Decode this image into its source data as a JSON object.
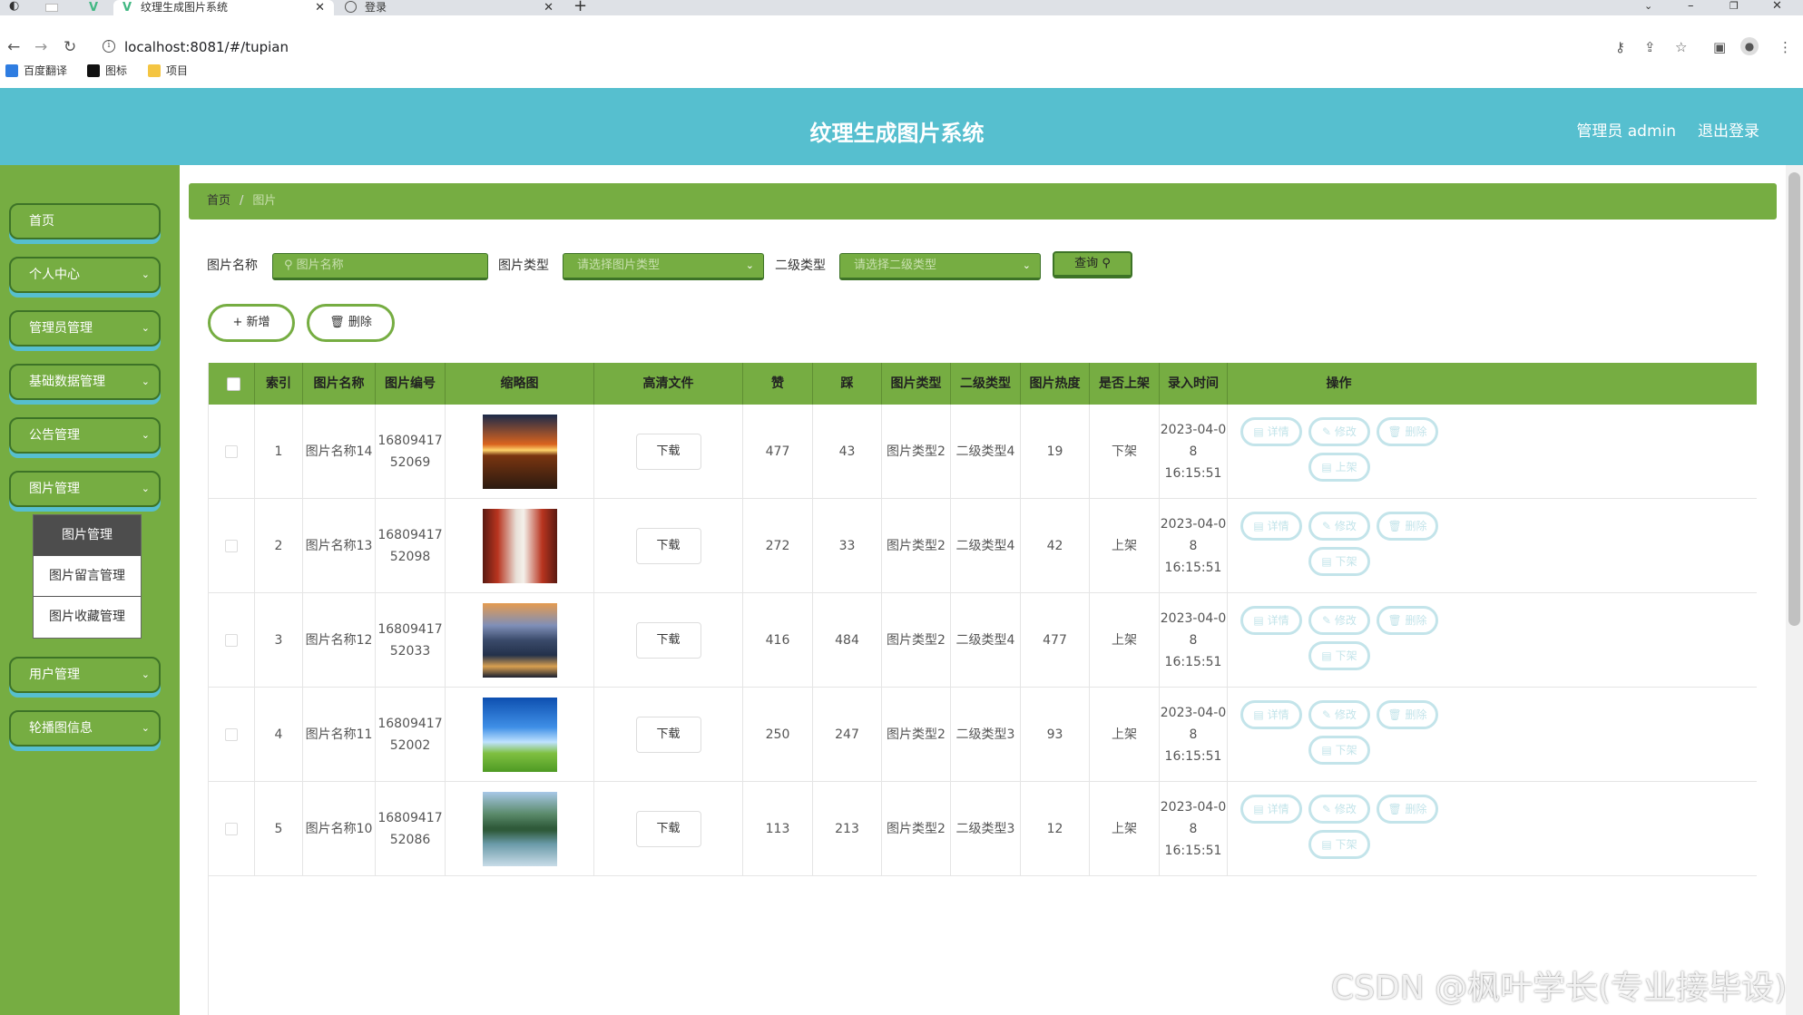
{
  "browser": {
    "tabs": [
      {
        "title": "纹理生成图片系统",
        "active": true
      },
      {
        "title": "登录",
        "active": false
      }
    ],
    "url": "localhost:8081/#/tupian",
    "bookmarks": [
      "百度翻译",
      "图标",
      "项目"
    ]
  },
  "header": {
    "title": "纹理生成图片系统",
    "user": "管理员 admin",
    "logout": "退出登录",
    "color": "#56bfcf"
  },
  "sidebar": {
    "color": "#76ad42",
    "items": [
      {
        "label": "首页"
      },
      {
        "label": "个人中心"
      },
      {
        "label": "管理员管理"
      },
      {
        "label": "基础数据管理"
      },
      {
        "label": "公告管理"
      },
      {
        "label": "图片管理"
      },
      {
        "label": "用户管理"
      },
      {
        "label": "轮播图信息"
      }
    ],
    "submenu": [
      "图片管理",
      "图片留言管理",
      "图片收藏管理"
    ]
  },
  "breadcrumb": {
    "home": "首页",
    "separator": "/",
    "current": "图片"
  },
  "filters": {
    "name_label": "图片名称",
    "name_placeholder": "图片名称",
    "type_label": "图片类型",
    "type_placeholder": "请选择图片类型",
    "subtype_label": "二级类型",
    "subtype_placeholder": "请选择二级类型",
    "query": "查询"
  },
  "actions": {
    "add": "+ 新增",
    "delete": "删除"
  },
  "table": {
    "headers": [
      "索引",
      "图片名称",
      "图片编号",
      "缩略图",
      "高清文件",
      "赞",
      "踩",
      "图片类型",
      "二级类型",
      "图片热度",
      "是否上架",
      "录入时间",
      "操作"
    ],
    "download_label": "下载",
    "op_labels": {
      "detail": "详情",
      "edit": "修改",
      "delete": "删除"
    },
    "rows": [
      {
        "index": "1",
        "name": "图片名称14",
        "code1": "16809417",
        "code2": "52069",
        "like": "477",
        "dislike": "43",
        "type": "图片类型2",
        "subtype": "二级类型4",
        "heat": "19",
        "status": "下架",
        "date1": "2023-04-0",
        "date2": "8 16:15:51",
        "toggle": "上架",
        "thumb": "sunset-road"
      },
      {
        "index": "2",
        "name": "图片名称13",
        "code1": "16809417",
        "code2": "52098",
        "like": "272",
        "dislike": "33",
        "type": "图片类型2",
        "subtype": "二级类型4",
        "heat": "42",
        "status": "上架",
        "date1": "2023-04-0",
        "date2": "8 16:15:51",
        "toggle": "下架",
        "thumb": "red-corridor"
      },
      {
        "index": "3",
        "name": "图片名称12",
        "code1": "16809417",
        "code2": "52033",
        "like": "416",
        "dislike": "484",
        "type": "图片类型2",
        "subtype": "二级类型4",
        "heat": "477",
        "status": "上架",
        "date1": "2023-04-0",
        "date2": "8 16:15:51",
        "toggle": "下架",
        "thumb": "mountain-city"
      },
      {
        "index": "4",
        "name": "图片名称11",
        "code1": "16809417",
        "code2": "52002",
        "like": "250",
        "dislike": "247",
        "type": "图片类型2",
        "subtype": "二级类型3",
        "heat": "93",
        "status": "上架",
        "date1": "2023-04-0",
        "date2": "8 16:15:51",
        "toggle": "下架",
        "thumb": "sky-meadow"
      },
      {
        "index": "5",
        "name": "图片名称10",
        "code1": "16809417",
        "code2": "52086",
        "like": "113",
        "dislike": "213",
        "type": "图片类型2",
        "subtype": "二级类型3",
        "heat": "12",
        "status": "上架",
        "date1": "2023-04-0",
        "date2": "8 16:15:51",
        "toggle": "下架",
        "thumb": "karst-lake"
      }
    ]
  },
  "watermark": "CSDN @枫叶学长(专业接毕设)"
}
